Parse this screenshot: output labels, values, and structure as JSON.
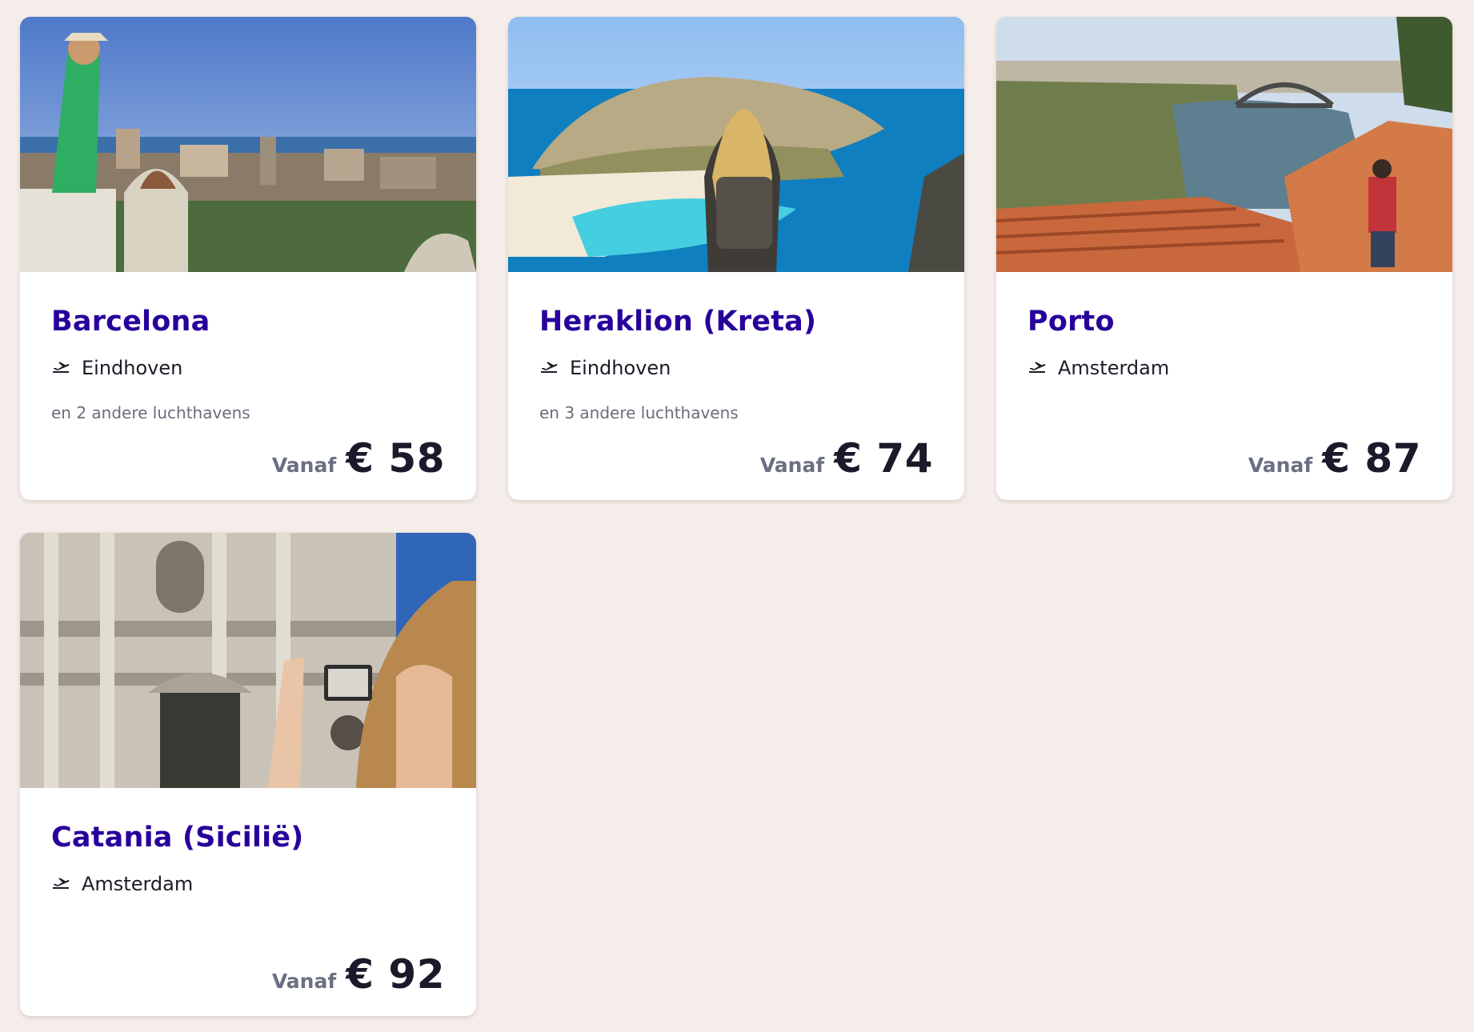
{
  "cards": [
    {
      "city": "Barcelona",
      "airport": "Eindhoven",
      "other_airports": "en 2 andere luchthavens",
      "price_prefix": "Vanaf",
      "price": "€ 58",
      "image": "barcelona-photo"
    },
    {
      "city": "Heraklion (Kreta)",
      "airport": "Eindhoven",
      "other_airports": "en 3 andere luchthavens",
      "price_prefix": "Vanaf",
      "price": "€ 74",
      "image": "heraklion-photo"
    },
    {
      "city": "Porto",
      "airport": "Amsterdam",
      "other_airports": "",
      "price_prefix": "Vanaf",
      "price": "€ 87",
      "image": "porto-photo"
    },
    {
      "city": "Catania (Sicilië)",
      "airport": "Amsterdam",
      "other_airports": "",
      "price_prefix": "Vanaf",
      "price": "€ 92",
      "image": "catania-photo"
    }
  ],
  "colors": {
    "background": "#f5ede9",
    "card": "#ffffff",
    "city_title": "#28009b",
    "price": "#1a1a2a",
    "muted": "#6a6d7c"
  },
  "icons": {
    "departure": "plane-departure-icon"
  }
}
